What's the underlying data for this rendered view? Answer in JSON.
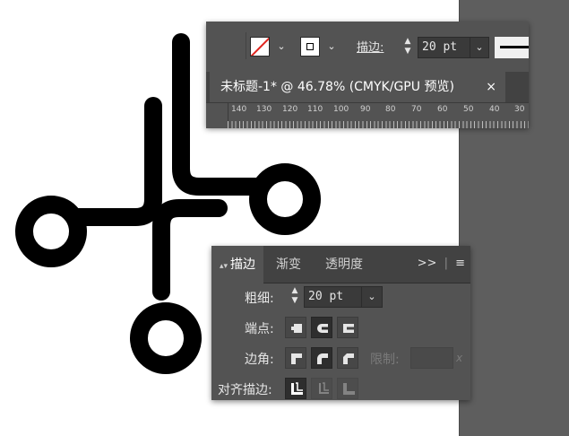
{
  "control_bar": {
    "fill_swatch": "fill-none-swatch",
    "stroke_swatch": "stroke-swatch",
    "stroke_label": "描边",
    "stroke_colon": ":",
    "stroke_weight": "20 pt"
  },
  "document_tab": {
    "title": "未标题-1* @ 46.78% (CMYK/GPU 预览)",
    "close": "×"
  },
  "ruler": {
    "labels": [
      "140",
      "130",
      "120",
      "110",
      "100",
      "90",
      "80",
      "70",
      "60",
      "50",
      "40",
      "30"
    ]
  },
  "stroke_panel": {
    "tabs": [
      {
        "label": "描边",
        "active": true
      },
      {
        "label": "渐变",
        "active": false
      },
      {
        "label": "透明度",
        "active": false
      }
    ],
    "collapse_icon": ">>",
    "menu_icon": "≡",
    "weight_label": "粗细",
    "weight_value": "20 pt",
    "cap_label": "端点",
    "corner_label": "边角",
    "limit_label": "限制",
    "limit_unit": "x",
    "align_label": "对齐描边",
    "colon": ":"
  },
  "colors": {
    "panel_bg": "#535353",
    "tab_bar_bg": "#424242",
    "input_bg": "#3a3a3a",
    "fill_none_slash": "#e0231d",
    "canvas_bg": "#ffffff",
    "pasteboard": "#5e5e5e"
  }
}
